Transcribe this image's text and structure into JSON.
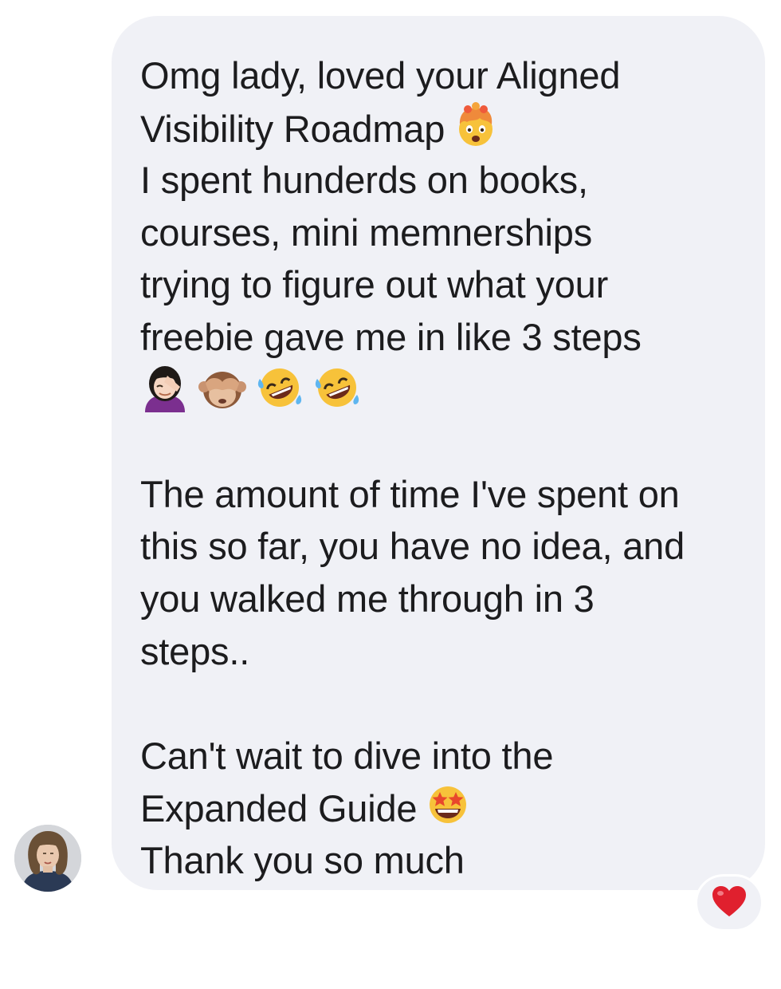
{
  "message": {
    "lines": [
      "Omg lady, loved your Aligned",
      "Visibility Roadmap",
      "I spent hunderds on books,",
      "courses, mini memnerships",
      "trying to figure out what your",
      "freebie gave me in like 3 steps",
      "The amount of time I've spent on",
      "this so far, you have no idea, and",
      "you walked me through in 3",
      "steps..",
      "Can't wait to dive into the",
      "Expanded Guide",
      "Thank you so much"
    ],
    "emojis": {
      "after_roadmap": "exploding-head-emoji",
      "reaction_row": [
        "woman-facepalming-emoji",
        "see-no-evil-monkey-emoji",
        "rolling-on-floor-laughing-emoji",
        "rolling-on-floor-laughing-emoji"
      ],
      "after_guide": "star-struck-emoji"
    }
  },
  "reaction": {
    "icon": "red-heart-icon"
  },
  "colors": {
    "bubble": "#f0f1f6",
    "text": "#1c1c1e",
    "heart": "#e0202e"
  }
}
